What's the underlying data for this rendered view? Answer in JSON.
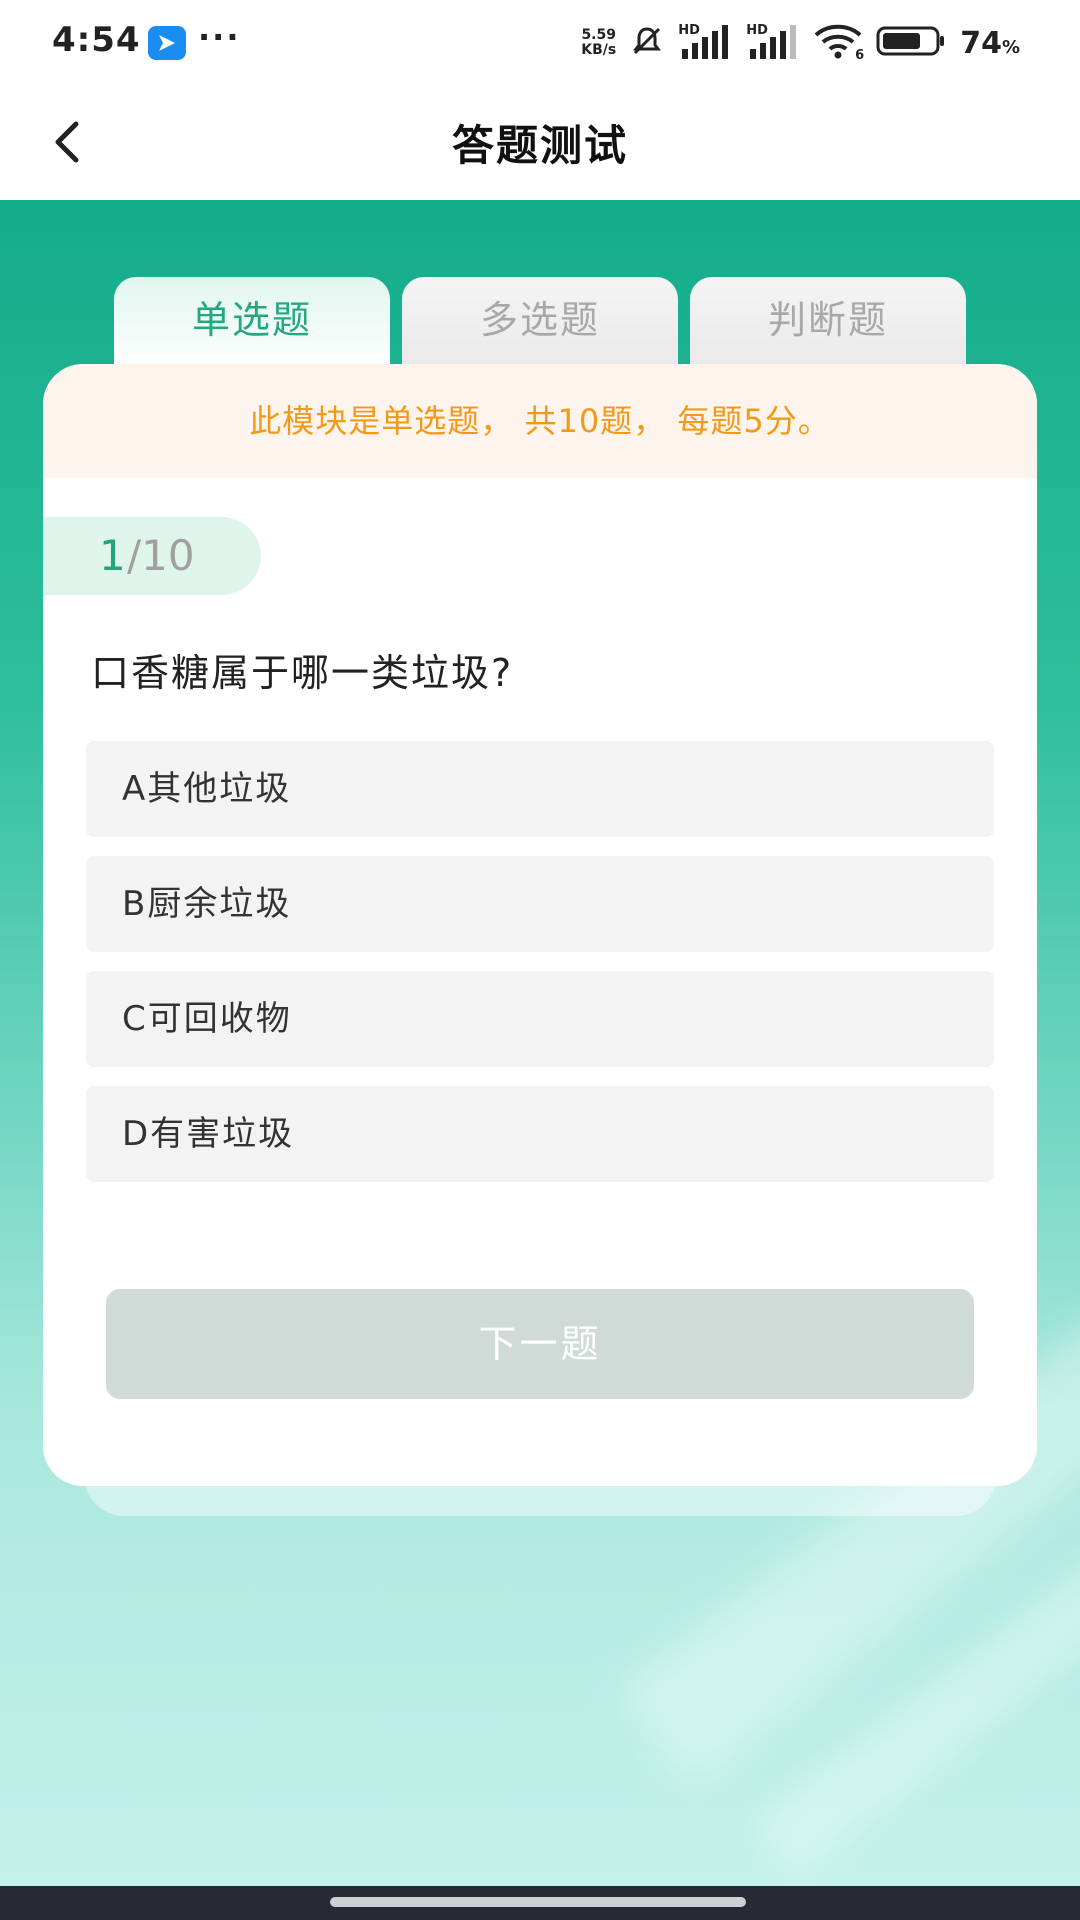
{
  "status_bar": {
    "time": "4:54",
    "more": "···",
    "net_speed_value": "5.59",
    "net_speed_unit": "KB/s",
    "signal_label_1": "HD",
    "signal_label_2": "HD",
    "wifi_label": "6",
    "battery_value": "74",
    "battery_unit": "%",
    "battery_level": 0.74
  },
  "header": {
    "title": "答题测试"
  },
  "tabs": [
    {
      "label": "单选题",
      "active": true
    },
    {
      "label": "多选题",
      "active": false
    },
    {
      "label": "判断题",
      "active": false
    }
  ],
  "quiz": {
    "notice": "此模块是单选题， 共10题， 每题5分。",
    "progress_current": "1",
    "progress_total": "/10",
    "question": "口香糖属于哪一类垃圾?",
    "options": [
      {
        "label": "A其他垃圾"
      },
      {
        "label": "B厨余垃圾"
      },
      {
        "label": "C可回收物"
      },
      {
        "label": "D有害垃圾"
      }
    ],
    "next_label": "下一题"
  },
  "colors": {
    "accent": "#24a87f",
    "notice_text": "#f29a18",
    "disabled_button": "#d0dbd7"
  }
}
